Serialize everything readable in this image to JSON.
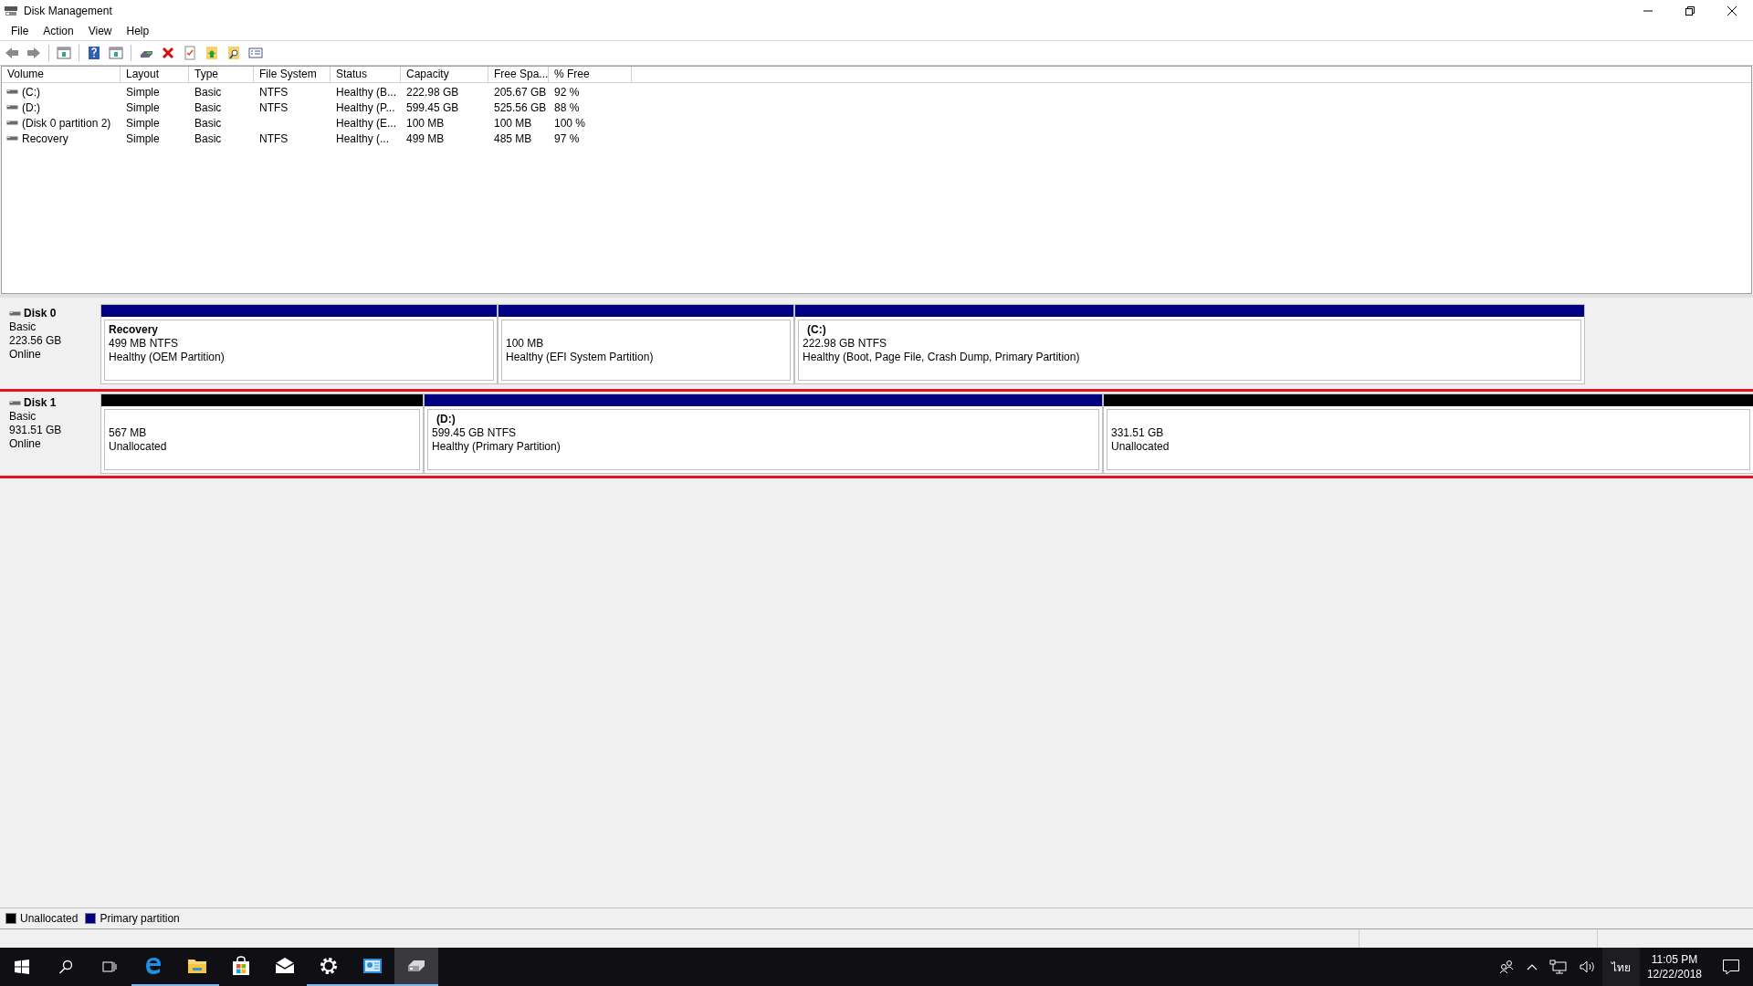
{
  "window": {
    "title": "Disk Management"
  },
  "menu": [
    "File",
    "Action",
    "View",
    "Help"
  ],
  "table": {
    "columns": [
      "Volume",
      "Layout",
      "Type",
      "File System",
      "Status",
      "Capacity",
      "Free Spa...",
      "% Free"
    ],
    "rows": [
      {
        "cells": [
          "(C:)",
          "Simple",
          "Basic",
          "NTFS",
          "Healthy (B...",
          "222.98 GB",
          "205.67 GB",
          "92 %"
        ]
      },
      {
        "cells": [
          "(D:)",
          "Simple",
          "Basic",
          "NTFS",
          "Healthy (P...",
          "599.45 GB",
          "525.56 GB",
          "88 %"
        ]
      },
      {
        "cells": [
          "(Disk 0 partition 2)",
          "Simple",
          "Basic",
          "",
          "Healthy (E...",
          "100 MB",
          "100 MB",
          "100 %"
        ]
      },
      {
        "cells": [
          "Recovery",
          "Simple",
          "Basic",
          "NTFS",
          "Healthy (...",
          "499 MB",
          "485 MB",
          "97 %"
        ]
      }
    ]
  },
  "disks": [
    {
      "name": "Disk 0",
      "type": "Basic",
      "size": "223.56 GB",
      "status": "Online",
      "highlighted": false,
      "partitions": [
        {
          "kind": "primary",
          "name": "Recovery",
          "size": "499 MB NTFS",
          "status": "Healthy (OEM Partition)"
        },
        {
          "kind": "primary",
          "size": "100 MB",
          "status": "Healthy (EFI System Partition)"
        },
        {
          "kind": "primary",
          "name": "(C:)",
          "size": "222.98 GB NTFS",
          "status": "Healthy (Boot, Page File, Crash Dump, Primary Partition)"
        }
      ]
    },
    {
      "name": "Disk 1",
      "type": "Basic",
      "size": "931.51 GB",
      "status": "Online",
      "highlighted": true,
      "partitions": [
        {
          "kind": "unallocated",
          "size": "567 MB",
          "status": "Unallocated"
        },
        {
          "kind": "primary",
          "name": "(D:)",
          "size": "599.45 GB NTFS",
          "status": "Healthy (Primary Partition)"
        },
        {
          "kind": "unallocated",
          "size": "331.51 GB",
          "status": "Unallocated"
        }
      ]
    }
  ],
  "legend": [
    {
      "label": "Unallocated",
      "color": "#000000"
    },
    {
      "label": "Primary partition",
      "color": "#000080"
    }
  ],
  "taskbar": {
    "apps": [
      {
        "kind": "edge",
        "running": true,
        "selected": false
      },
      {
        "kind": "explorer",
        "running": true,
        "selected": false
      },
      {
        "kind": "store",
        "running": false,
        "selected": false
      },
      {
        "kind": "mail",
        "running": false,
        "selected": false
      },
      {
        "kind": "settings",
        "running": true,
        "selected": false
      },
      {
        "kind": "control",
        "running": true,
        "selected": false
      },
      {
        "kind": "disk",
        "running": true,
        "selected": true
      }
    ],
    "language": "ไทย",
    "time": "11:05 PM",
    "date": "12/22/2018"
  }
}
